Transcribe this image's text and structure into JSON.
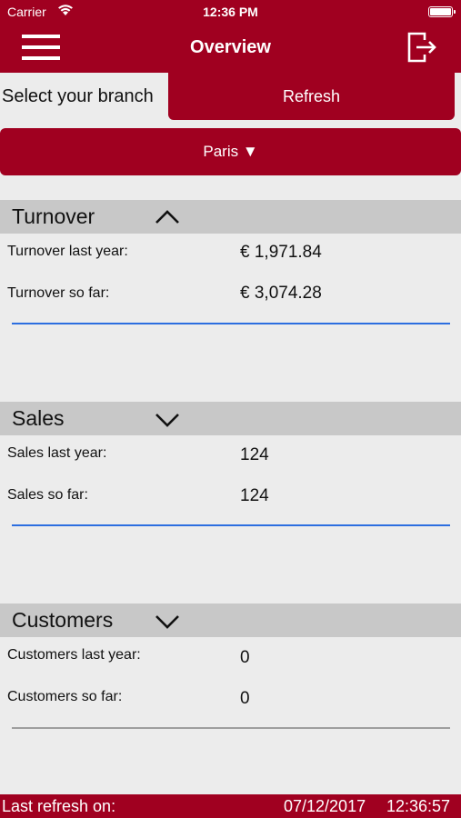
{
  "status_bar": {
    "carrier": "Carrier",
    "time": "12:36 PM"
  },
  "nav": {
    "title": "Overview",
    "menu_icon": "hamburger-menu-icon",
    "logout_icon": "logout-icon"
  },
  "branch": {
    "label": "Select your branch",
    "refresh_label": "Refresh",
    "selected": "Paris ▼"
  },
  "sections": {
    "turnover": {
      "title": "Turnover",
      "expanded": true,
      "last_year_label": "Turnover last year:",
      "last_year_value": "€ 1,971.84",
      "so_far_label": "Turnover so far:",
      "so_far_value": "€ 3,074.28",
      "progress_fraction": 1.0,
      "progress_color": "#2c6ee0"
    },
    "sales": {
      "title": "Sales",
      "expanded": false,
      "last_year_label": "Sales last year:",
      "last_year_value": "124",
      "so_far_label": "Sales so far:",
      "so_far_value": "124",
      "progress_fraction": 1.0,
      "progress_color": "#2c6ee0"
    },
    "customers": {
      "title": "Customers",
      "expanded": false,
      "last_year_label": "Customers last year:",
      "last_year_value": "0",
      "so_far_label": "Customers so far:",
      "so_far_value": "0",
      "progress_fraction": 0,
      "progress_color": "#9e9e9e"
    }
  },
  "footer": {
    "label": "Last refresh on:",
    "date": "07/12/2017",
    "time": "12:36:57"
  },
  "colors": {
    "accent": "#a00020",
    "background": "#ececec",
    "section_header": "#c8c8c8"
  }
}
